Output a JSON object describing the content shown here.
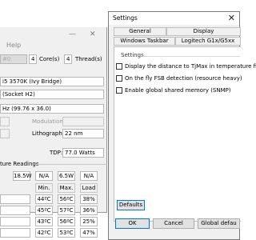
{
  "background_window": {
    "menu_help": "Help",
    "cpu_select": "#0",
    "cores_count": "4",
    "cores_label": "Core(s)",
    "threads_count": "4",
    "threads_label": "Thread(s)",
    "processor": "i5 3570K (Ivy Bridge)",
    "socket": "(Socket H2)",
    "frequency": "Hz (99.76 x 36.0)",
    "modulation_label": "Modulation:",
    "lithography_label": "Lithography:",
    "lithography_value": "22 nm",
    "tdp_label": "TDP:",
    "tdp_value": "77.0 Watts",
    "readings_title": "ture Readings",
    "power_row": [
      "18.5W",
      "N/A",
      "6.5W",
      "N/A"
    ],
    "readings_headers": [
      "Min.",
      "Max.",
      "Load"
    ],
    "readings": [
      [
        "44ºC",
        "56ºC",
        "38%"
      ],
      [
        "45ºC",
        "57ºC",
        "36%"
      ],
      [
        "43ºC",
        "56ºC",
        "25%"
      ],
      [
        "42ºC",
        "53ºC",
        "47%"
      ]
    ]
  },
  "dialog": {
    "title": "Settings",
    "close_glyph": "✕",
    "tabs_row1": [
      "General",
      "Display"
    ],
    "tabs_row2": [
      "Windows Taskbar",
      "Logitech G1x/G5xx"
    ],
    "group_label": "Settings",
    "options": [
      {
        "label": "Display the distance to TjMax in temperature fie"
      },
      {
        "label": "On the fly FSB detection (resource heavy)"
      },
      {
        "label": "Enable global shared memory (SNMP)"
      }
    ],
    "defaults_button": "Defaults",
    "ok_button": "OK",
    "cancel_button": "Cancel",
    "global_defaults_button": "Global defau"
  }
}
